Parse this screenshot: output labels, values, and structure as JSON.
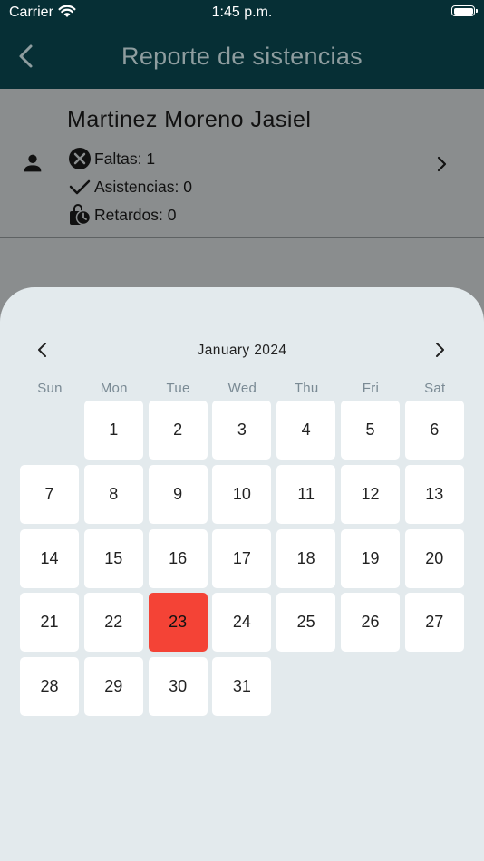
{
  "status_bar": {
    "carrier": "Carrier",
    "time": "1:45 p.m."
  },
  "nav": {
    "title": "Reporte de sistencias"
  },
  "student": {
    "name": "Martinez Moreno Jasiel",
    "faltas": "Faltas: 1",
    "asistencias": "Asistencias: 0",
    "retardos": "Retardos: 0"
  },
  "calendar": {
    "month_label": "January 2024",
    "weekdays": [
      "Sun",
      "Mon",
      "Tue",
      "Wed",
      "Thu",
      "Fri",
      "Sat"
    ],
    "first_weekday_index": 1,
    "days": [
      "1",
      "2",
      "3",
      "4",
      "5",
      "6",
      "7",
      "8",
      "9",
      "10",
      "11",
      "12",
      "13",
      "14",
      "15",
      "16",
      "17",
      "18",
      "19",
      "20",
      "21",
      "22",
      "23",
      "24",
      "25",
      "26",
      "27",
      "28",
      "29",
      "30",
      "31"
    ],
    "selected_day": "23"
  },
  "colors": {
    "header_bg": "#062f35",
    "selected_day": "#f44336",
    "sheet_bg": "#e3eaed"
  }
}
